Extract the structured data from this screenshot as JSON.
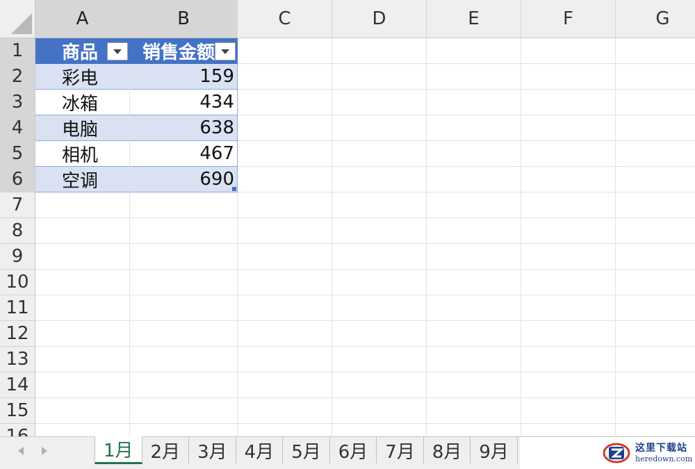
{
  "columns": [
    "A",
    "B",
    "C",
    "D",
    "E",
    "F",
    "G"
  ],
  "rows": [
    "1",
    "2",
    "3",
    "4",
    "5",
    "6",
    "7",
    "8",
    "9",
    "10",
    "11",
    "12",
    "13",
    "14",
    "15",
    "16"
  ],
  "table": {
    "headers": [
      "商品",
      "销售金额"
    ],
    "data": [
      {
        "item": "彩电",
        "amount": "159"
      },
      {
        "item": "冰箱",
        "amount": "434"
      },
      {
        "item": "电脑",
        "amount": "638"
      },
      {
        "item": "相机",
        "amount": "467"
      },
      {
        "item": "空调",
        "amount": "690"
      }
    ],
    "colors": {
      "header": "#4472c4",
      "band": "#d9e1f2",
      "border": "#8ea9db"
    }
  },
  "sheet_tabs": [
    "1月",
    "2月",
    "3月",
    "4月",
    "5月",
    "6月",
    "7月",
    "8月",
    "9月"
  ],
  "active_tab": "1月",
  "watermark": {
    "title": "这里下载站",
    "sub": "heredown.com"
  }
}
